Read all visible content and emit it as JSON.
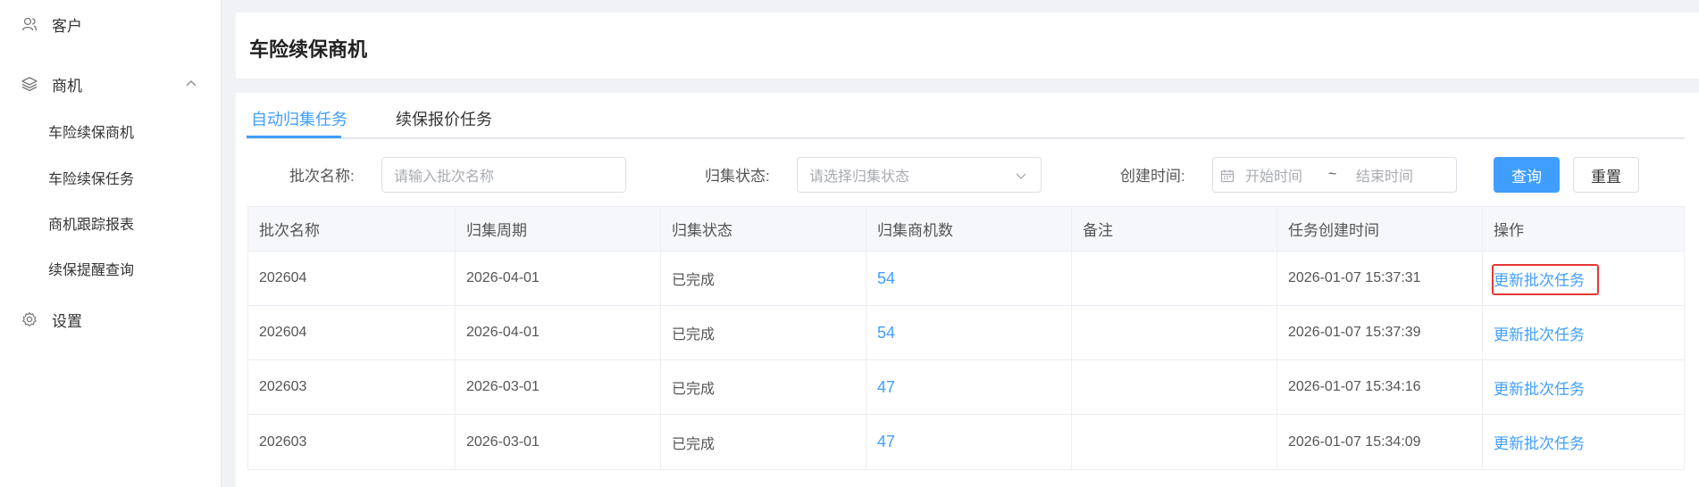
{
  "sidebar": {
    "customers": "客户",
    "opportunities": "商机",
    "sub_items": [
      "车险续保商机",
      "车险续保任务",
      "商机跟踪报表",
      "续保提醒查询"
    ],
    "settings": "设置"
  },
  "header": {
    "title": "车险续保商机"
  },
  "tabs": [
    {
      "label": "自动归集任务",
      "active": true
    },
    {
      "label": "续保报价任务",
      "active": false
    }
  ],
  "filters": {
    "batch_name_label": "批次名称:",
    "batch_name_placeholder": "请输入批次名称",
    "status_label": "归集状态:",
    "status_placeholder": "请选择归集状态",
    "created_label": "创建时间:",
    "start_placeholder": "开始时间",
    "range_sep": "~",
    "end_placeholder": "结束时间",
    "query_button": "查询",
    "reset_button": "重置"
  },
  "table": {
    "columns": [
      "批次名称",
      "归集周期",
      "归集状态",
      "归集商机数",
      "备注",
      "任务创建时间",
      "操作"
    ],
    "rows": [
      {
        "batch": "202604",
        "period": "2026-04-01",
        "status": "已完成",
        "count": "54",
        "note": "",
        "created": "2026-01-07 15:37:31",
        "action": "更新批次任务",
        "highlighted": true
      },
      {
        "batch": "202604",
        "period": "2026-04-01",
        "status": "已完成",
        "count": "54",
        "note": "",
        "created": "2026-01-07 15:37:39",
        "action": "更新批次任务",
        "highlighted": false
      },
      {
        "batch": "202603",
        "period": "2026-03-01",
        "status": "已完成",
        "count": "47",
        "note": "",
        "created": "2026-01-07 15:34:16",
        "action": "更新批次任务",
        "highlighted": false
      },
      {
        "batch": "202603",
        "period": "2026-03-01",
        "status": "已完成",
        "count": "47",
        "note": "",
        "created": "2026-01-07 15:34:09",
        "action": "更新批次任务",
        "highlighted": false
      }
    ]
  },
  "colors": {
    "accent": "#409eff",
    "highlight": "#e53935"
  }
}
